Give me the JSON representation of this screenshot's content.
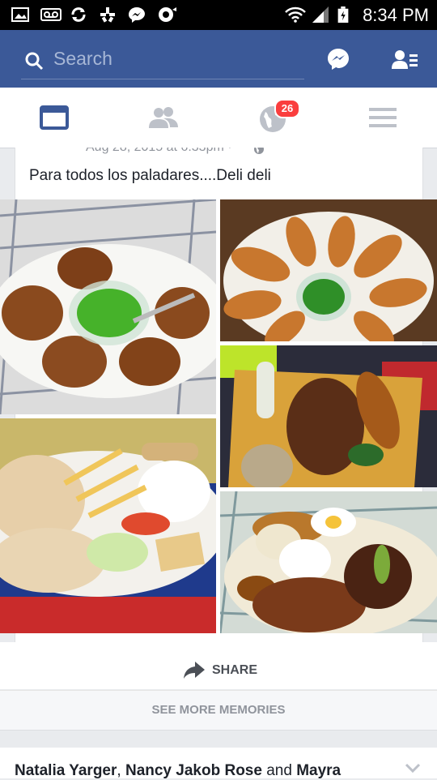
{
  "status_bar": {
    "time": "8:34 PM",
    "icons": [
      "gallery-icon",
      "voicemail-icon",
      "sync-icon",
      "yelp-icon",
      "messenger-icon",
      "voice-search-icon",
      "wifi-icon",
      "signal-icon",
      "battery-icon"
    ]
  },
  "header": {
    "search_placeholder": "Search",
    "icons": [
      "search-icon",
      "messenger-icon",
      "friend-requests-icon"
    ]
  },
  "tabs": {
    "items": [
      {
        "name": "news-feed",
        "icon": "news-feed-icon",
        "active": true
      },
      {
        "name": "friends",
        "icon": "friends-icon"
      },
      {
        "name": "notifications",
        "icon": "globe-icon",
        "badge": "26"
      },
      {
        "name": "more",
        "icon": "menu-icon"
      }
    ]
  },
  "post": {
    "date": "Aug 28, 2015 at 6:33pm ·",
    "privacy_icon": "globe-icon",
    "text": "Para todos los paladares....Deli deli",
    "photos": [
      "arepas-with-green-sauce",
      "empanadas-plate",
      "grilled-steak-board",
      "grilled-chicken-plate",
      "bandeja-paisa"
    ],
    "share_label": "SHARE"
  },
  "see_more": {
    "label": "SEE MORE MEMORIES"
  },
  "next_card": {
    "name1": "Natalia Yarger",
    "sep": ", ",
    "name2": "Nancy Jakob Rose",
    "and": " and ",
    "name3": "Mayra"
  },
  "colors": {
    "brand": "#3b5998",
    "badge": "#fa3e3e"
  }
}
